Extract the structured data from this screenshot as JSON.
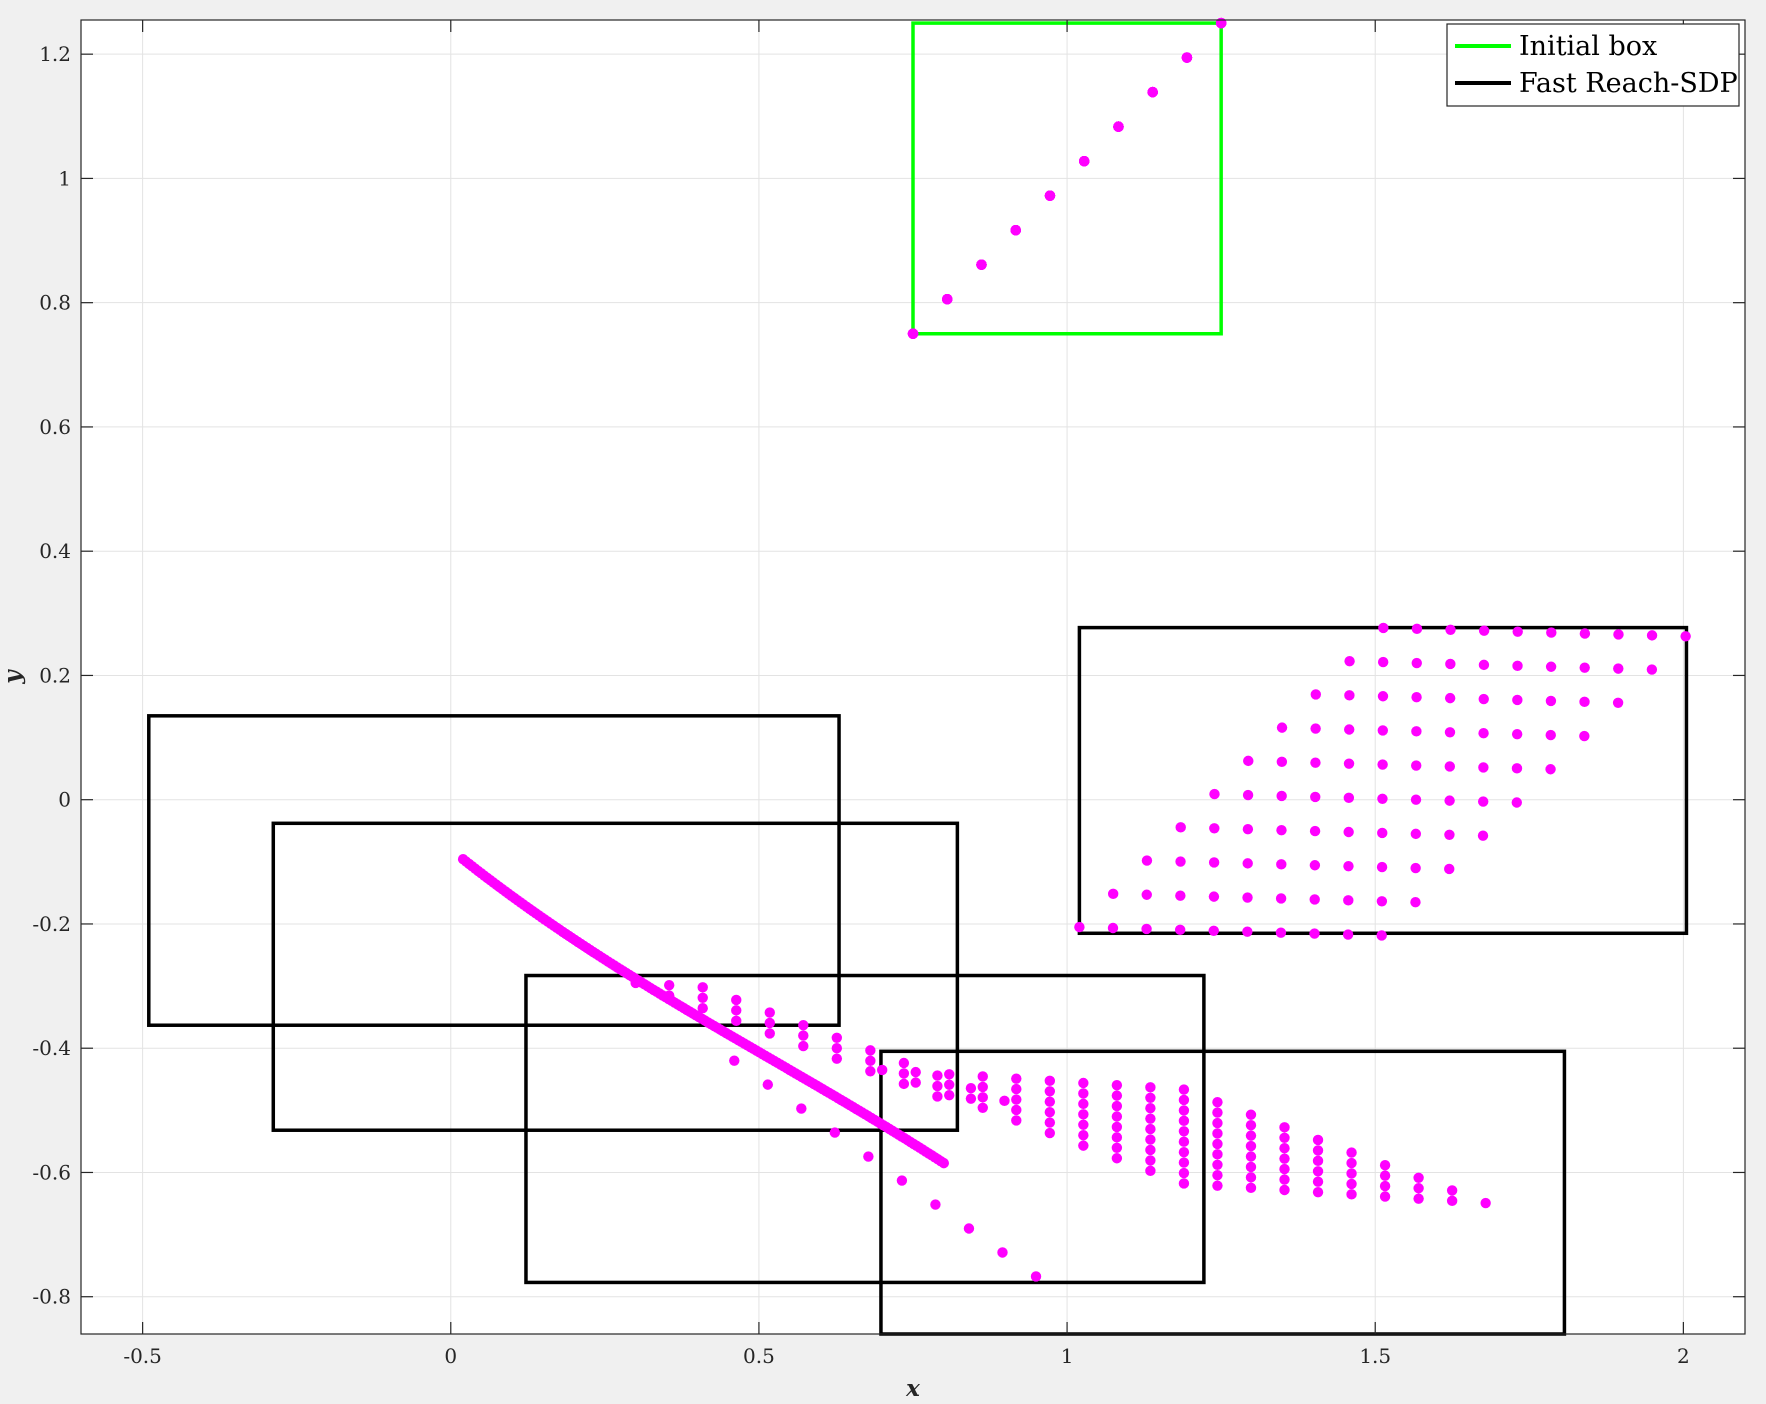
{
  "chart_data": {
    "type": "scatter",
    "title": "",
    "xlabel": "x",
    "ylabel": "y",
    "xlim": [
      -0.6,
      2.1
    ],
    "ylim": [
      -0.86,
      1.255
    ],
    "xticks": [
      -0.5,
      0,
      0.5,
      1,
      1.5,
      2
    ],
    "xtick_labels": [
      "-0.5",
      "0",
      "0.5",
      "1",
      "1.5",
      "2"
    ],
    "yticks": [
      -0.8,
      -0.6,
      -0.4,
      -0.2,
      0,
      0.2,
      0.4,
      0.6,
      0.8,
      1,
      1.2
    ],
    "ytick_labels": [
      "-0.8",
      "-0.6",
      "-0.4",
      "-0.2",
      "0",
      "0.2",
      "0.4",
      "0.6",
      "0.8",
      "1",
      "1.2"
    ],
    "grid": true,
    "legend_position": "top-right",
    "legend": [
      {
        "label": "Initial box",
        "color": "#00ff00"
      },
      {
        "label": "Fast Reach-SDP",
        "color": "#000000"
      }
    ],
    "colors": {
      "samples": "#ff00ff",
      "initial_box": "#00ff00",
      "reach_box": "#000000"
    },
    "initial_box": {
      "x": [
        0.75,
        1.25
      ],
      "y": [
        0.75,
        1.25
      ]
    },
    "reach_boxes": [
      {
        "x": [
          1.02,
          2.005
        ],
        "y": [
          -0.215,
          0.277
        ]
      },
      {
        "x": [
          -0.49,
          0.63
        ],
        "y": [
          -0.363,
          0.135
        ]
      },
      {
        "x": [
          -0.288,
          0.822
        ],
        "y": [
          -0.532,
          -0.038
        ]
      },
      {
        "x": [
          0.122,
          1.222
        ],
        "y": [
          -0.777,
          -0.283
        ]
      },
      {
        "x": [
          0.698,
          1.807
        ],
        "y": [
          -0.86,
          -0.405
        ]
      }
    ],
    "sample_sets": [
      {
        "name": "Initial samples",
        "kind": "grid",
        "x0": 0.75,
        "y0": 0.75,
        "dx": 0.05556,
        "dy": 0.05556,
        "nx": 10,
        "ny": 10,
        "sx": 0,
        "sy": 0
      },
      {
        "name": "Step 1 samples",
        "kind": "grid",
        "x0": 1.02,
        "y0": -0.205,
        "dx": 0.0545,
        "dy": -0.0015,
        "nx": 10,
        "ny": 10,
        "sx": 0.0548,
        "sy": 0.0535
      },
      {
        "name": "Step 4 samples A",
        "kind": "grid",
        "x0": 0.7,
        "y0": -0.435,
        "dx": 0.0544,
        "dy": -0.0203,
        "nx": 10,
        "ny": 10,
        "sx": 0.0544,
        "sy": -0.0035
      },
      {
        "name": "Step 4 samples B",
        "kind": "grid",
        "x0": 0.3,
        "y0": -0.295,
        "dx": 0.0544,
        "dy": -0.0203,
        "nx": 10,
        "ny": 3,
        "sx": 0.0544,
        "sy": -0.0035
      },
      {
        "name": "Step 3 lower branch",
        "kind": "grid",
        "x0": 0.46,
        "y0": -0.42,
        "dx": 0.0544,
        "dy": -0.0386,
        "nx": 10,
        "ny": 1,
        "sx": 0,
        "sy": 0
      },
      {
        "name": "Step 2-3 chain",
        "kind": "curve",
        "x0": 0.02,
        "x1": 0.8,
        "n": 160,
        "a": 0.08,
        "b": 0.8,
        "c": 0.87
      }
    ]
  }
}
